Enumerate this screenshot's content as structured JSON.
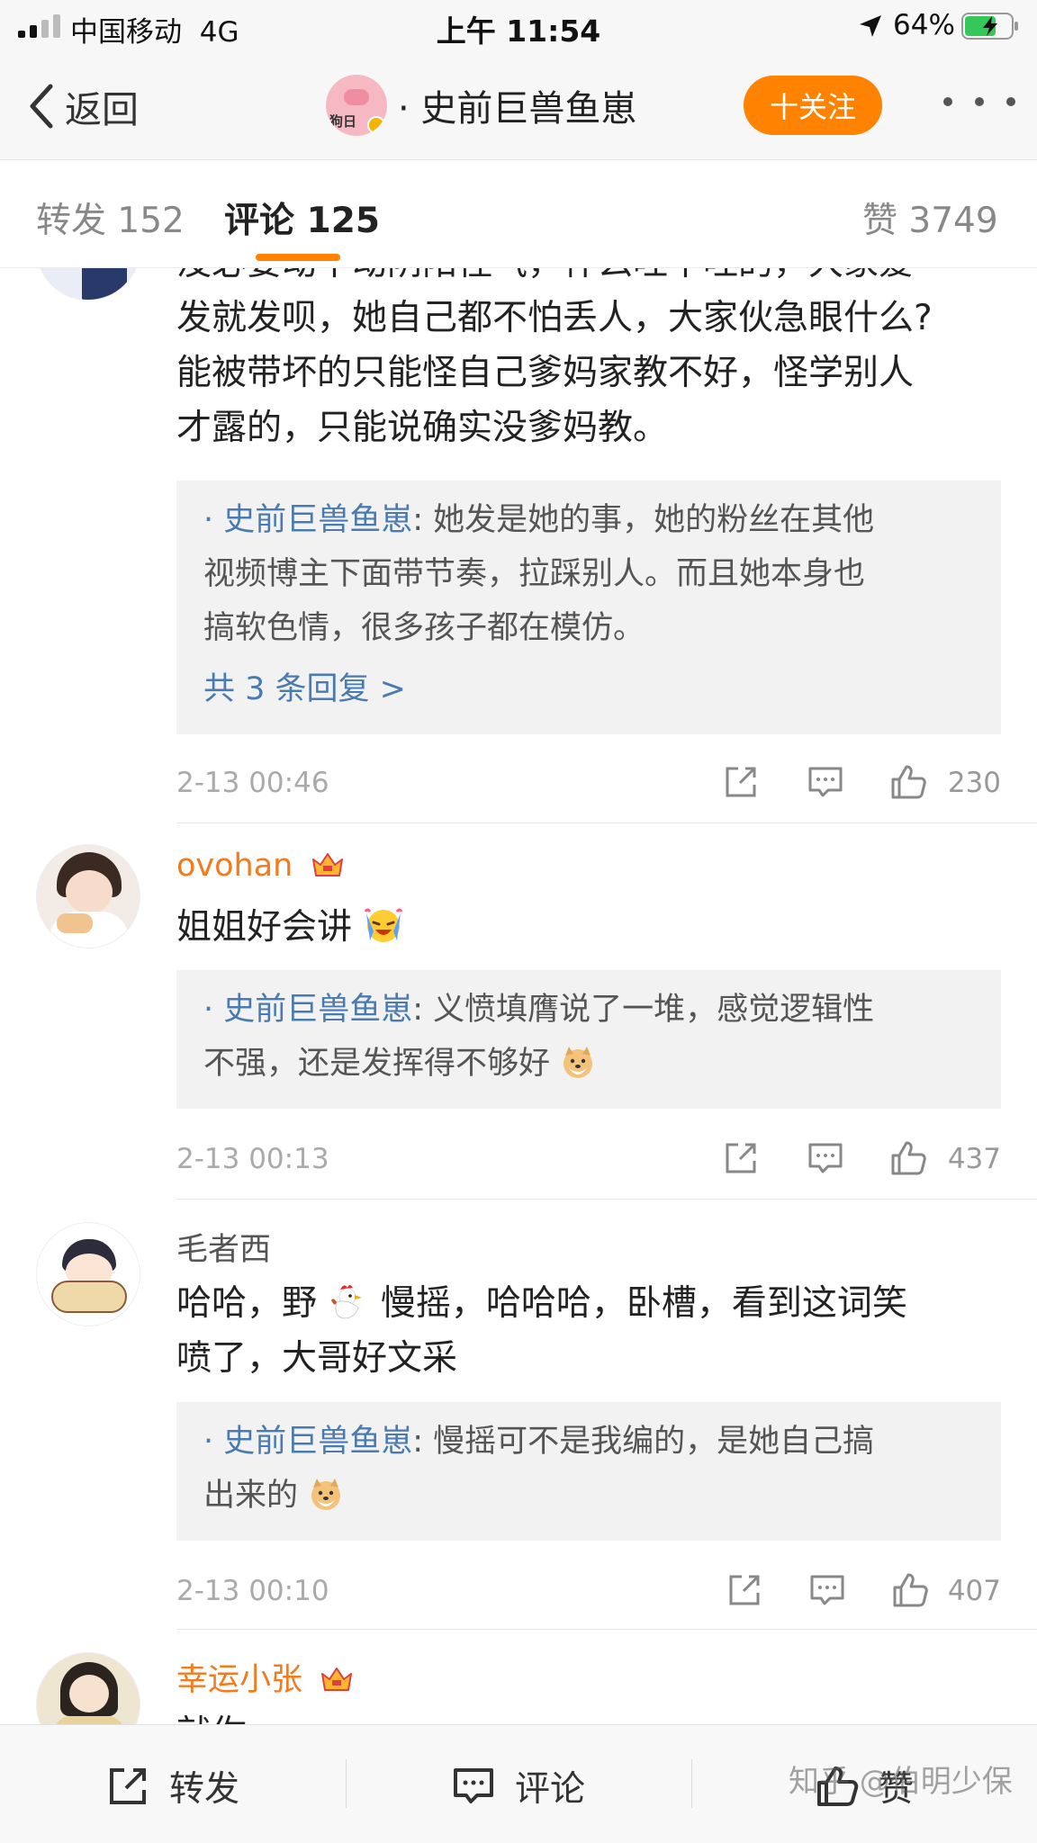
{
  "status_bar": {
    "carrier": "中国移动",
    "network": "4G",
    "time": "上午 11:54",
    "battery": "64%"
  },
  "nav": {
    "back_label": "返回",
    "avatar_text": "狗日",
    "title": "· 史前巨兽鱼崽",
    "follow_label": "十关注"
  },
  "tabs": [
    {
      "label": "转发 152"
    },
    {
      "label": "评论 125"
    },
    {
      "label": "赞 3749"
    }
  ],
  "comments": [
    {
      "name": "",
      "text_lines": [
        "没必要动不动阴阳怪气，什么吐不吐的，大家爱",
        "发就发呗，她自己都不怕丢人，大家伙急眼什么?",
        "能被带坏的只能怪自己爹妈家教不好，怪学别人",
        "才露的，只能说确实没爹妈教。"
      ],
      "reply": {
        "author": "· 史前巨兽鱼崽",
        "lines": [
          ": 她发是她的事，她的粉丝在其他",
          "视频博主下面带节奏，拉踩别人。而且她本身也",
          "搞软色情，很多孩子都在模仿。"
        ],
        "more": "共 3 条回复 >"
      },
      "time": "2-13 00:46",
      "likes": "230"
    },
    {
      "name": "ovohan",
      "text_lines": [
        "姐姐好会讲"
      ],
      "reply": {
        "author": "· 史前巨兽鱼崽",
        "lines": [
          ": 义愤填膺说了一堆，感觉逻辑性",
          "不强，还是发挥得不够好"
        ]
      },
      "time": "2-13 00:13",
      "likes": "437"
    },
    {
      "name": "毛者西",
      "text_lines": [
        "哈哈，野",
        "慢摇，哈哈哈，卧槽，看到这词笑",
        "喷了，大哥好文采"
      ],
      "reply": {
        "author": "· 史前巨兽鱼崽",
        "lines": [
          ": 慢摇可不是我编的，是她自己搞",
          "出来的"
        ]
      },
      "time": "2-13 00:10",
      "likes": "407"
    },
    {
      "name": "幸运小张",
      "text_lines": [
        "就你"
      ]
    }
  ],
  "bottom_bar": {
    "repost": "转发",
    "comment": "评论",
    "like": "赞"
  },
  "watermark": "知乎 @伯明少保",
  "colors": {
    "accent": "#ff8200",
    "link": "#4a7bb0",
    "vip_name": "#f27a1f"
  }
}
